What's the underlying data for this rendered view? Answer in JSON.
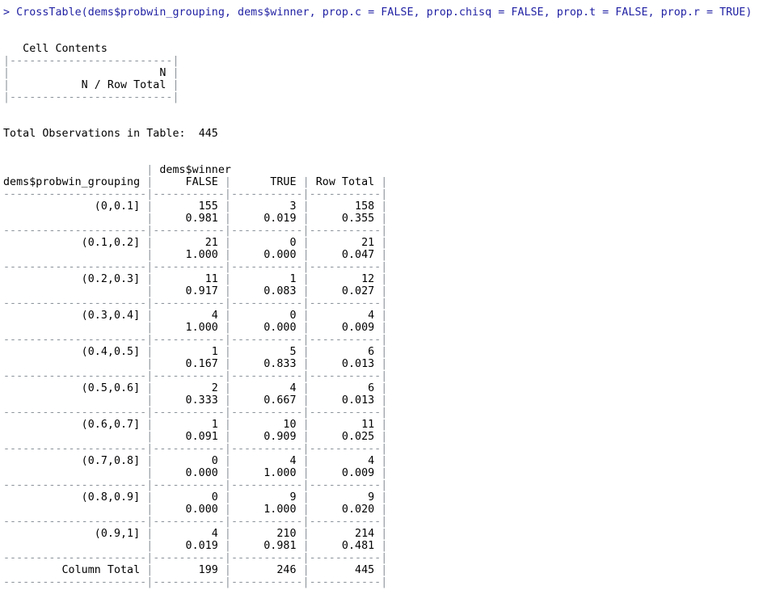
{
  "console": {
    "prompt": ">",
    "command": "CrossTable(dems$probwin_grouping, dems$winner, prop.c = FALSE, prop.chisq = FALSE, prop.t = FALSE, prop.r = TRUE)",
    "colors": {
      "command": "#1f1fa3",
      "text": "#000000",
      "pipe": "#8e959c"
    }
  },
  "cell_contents": {
    "title": "Cell Contents",
    "lines": [
      "N",
      "N / Row Total"
    ]
  },
  "total_observations": {
    "label": "Total Observations in Table:",
    "value": "445"
  },
  "crosstab": {
    "row_var": "dems$probwin_grouping",
    "col_var": "dems$winner",
    "columns": [
      "FALSE",
      "TRUE",
      "Row Total"
    ],
    "rows": [
      {
        "label": "(0,0.1]",
        "n": [
          "155",
          "3",
          "158"
        ],
        "prop": [
          "0.981",
          "0.019",
          "0.355"
        ]
      },
      {
        "label": "(0.1,0.2]",
        "n": [
          "21",
          "0",
          "21"
        ],
        "prop": [
          "1.000",
          "0.000",
          "0.047"
        ]
      },
      {
        "label": "(0.2,0.3]",
        "n": [
          "11",
          "1",
          "12"
        ],
        "prop": [
          "0.917",
          "0.083",
          "0.027"
        ]
      },
      {
        "label": "(0.3,0.4]",
        "n": [
          "4",
          "0",
          "4"
        ],
        "prop": [
          "1.000",
          "0.000",
          "0.009"
        ]
      },
      {
        "label": "(0.4,0.5]",
        "n": [
          "1",
          "5",
          "6"
        ],
        "prop": [
          "0.167",
          "0.833",
          "0.013"
        ]
      },
      {
        "label": "(0.5,0.6]",
        "n": [
          "2",
          "4",
          "6"
        ],
        "prop": [
          "0.333",
          "0.667",
          "0.013"
        ]
      },
      {
        "label": "(0.6,0.7]",
        "n": [
          "1",
          "10",
          "11"
        ],
        "prop": [
          "0.091",
          "0.909",
          "0.025"
        ]
      },
      {
        "label": "(0.7,0.8]",
        "n": [
          "0",
          "4",
          "4"
        ],
        "prop": [
          "0.000",
          "1.000",
          "0.009"
        ]
      },
      {
        "label": "(0.8,0.9]",
        "n": [
          "0",
          "9",
          "9"
        ],
        "prop": [
          "0.000",
          "1.000",
          "0.020"
        ]
      },
      {
        "label": "(0.9,1]",
        "n": [
          "4",
          "210",
          "214"
        ],
        "prop": [
          "0.019",
          "0.981",
          "0.481"
        ]
      }
    ],
    "column_total": {
      "label": "Column Total",
      "values": [
        "199",
        "246",
        "445"
      ]
    }
  }
}
